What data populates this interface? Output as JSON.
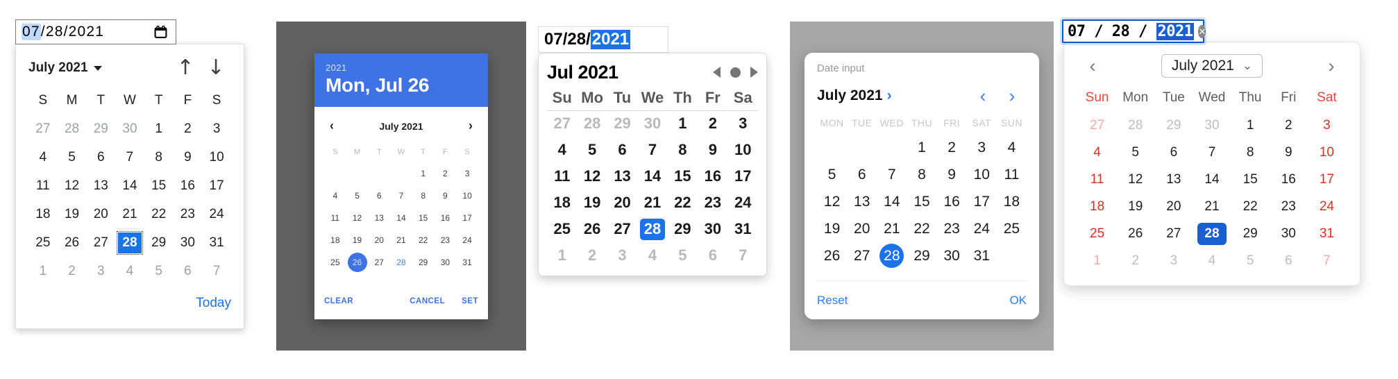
{
  "panels": [
    {
      "id": "chrome-date-picker",
      "input": {
        "month": "07",
        "day": "28",
        "year": "2021",
        "sep": "/",
        "selected_segment": "month",
        "icon": "calendar-icon"
      },
      "header": {
        "month_year": "July 2021",
        "caret": "chevron-down-icon",
        "prev_icon": "arrow-up-icon",
        "next_icon": "arrow-down-icon"
      },
      "weekdays": [
        "S",
        "M",
        "T",
        "W",
        "T",
        "F",
        "S"
      ],
      "weeks": [
        [
          {
            "d": "27",
            "o": true
          },
          {
            "d": "28",
            "o": true
          },
          {
            "d": "29",
            "o": true
          },
          {
            "d": "30",
            "o": true
          },
          {
            "d": "1"
          },
          {
            "d": "2"
          },
          {
            "d": "3"
          }
        ],
        [
          {
            "d": "4"
          },
          {
            "d": "5"
          },
          {
            "d": "6"
          },
          {
            "d": "7"
          },
          {
            "d": "8"
          },
          {
            "d": "9"
          },
          {
            "d": "10"
          }
        ],
        [
          {
            "d": "11"
          },
          {
            "d": "12"
          },
          {
            "d": "13"
          },
          {
            "d": "14"
          },
          {
            "d": "15"
          },
          {
            "d": "16"
          },
          {
            "d": "17"
          }
        ],
        [
          {
            "d": "18"
          },
          {
            "d": "19"
          },
          {
            "d": "20"
          },
          {
            "d": "21"
          },
          {
            "d": "22"
          },
          {
            "d": "23"
          },
          {
            "d": "24"
          }
        ],
        [
          {
            "d": "25"
          },
          {
            "d": "26"
          },
          {
            "d": "27"
          },
          {
            "d": "28",
            "s": true
          },
          {
            "d": "29"
          },
          {
            "d": "30"
          },
          {
            "d": "31"
          }
        ],
        [
          {
            "d": "1",
            "o": true
          },
          {
            "d": "2",
            "o": true
          },
          {
            "d": "3",
            "o": true
          },
          {
            "d": "4",
            "o": true
          },
          {
            "d": "5",
            "o": true
          },
          {
            "d": "6",
            "o": true
          },
          {
            "d": "7",
            "o": true
          }
        ]
      ],
      "footer": {
        "today_label": "Today"
      },
      "accent": "#1a73e8"
    },
    {
      "id": "material-date-picker",
      "backdrop": "#616161",
      "header": {
        "year": "2021",
        "date": "Mon, Jul 26",
        "bg": "#3f72e3"
      },
      "nav": {
        "prev_icon": "chevron-left-icon",
        "month_year": "July 2021",
        "next_icon": "chevron-right-icon"
      },
      "weekdays": [
        "S",
        "M",
        "T",
        "W",
        "T",
        "F",
        "S"
      ],
      "weeks": [
        [
          {
            "d": ""
          },
          {
            "d": ""
          },
          {
            "d": ""
          },
          {
            "d": ""
          },
          {
            "d": "1"
          },
          {
            "d": "2"
          },
          {
            "d": "3"
          }
        ],
        [
          {
            "d": "4"
          },
          {
            "d": "5"
          },
          {
            "d": "6"
          },
          {
            "d": "7"
          },
          {
            "d": "8"
          },
          {
            "d": "9"
          },
          {
            "d": "10"
          }
        ],
        [
          {
            "d": "11"
          },
          {
            "d": "12"
          },
          {
            "d": "13"
          },
          {
            "d": "14"
          },
          {
            "d": "15"
          },
          {
            "d": "16"
          },
          {
            "d": "17"
          }
        ],
        [
          {
            "d": "18"
          },
          {
            "d": "19"
          },
          {
            "d": "20"
          },
          {
            "d": "21"
          },
          {
            "d": "22"
          },
          {
            "d": "23"
          },
          {
            "d": "24"
          }
        ],
        [
          {
            "d": "25"
          },
          {
            "d": "26",
            "s": true
          },
          {
            "d": "27"
          },
          {
            "d": "28",
            "t": true
          },
          {
            "d": "29"
          },
          {
            "d": "30"
          },
          {
            "d": "31"
          }
        ]
      ],
      "actions": {
        "clear": "CLEAR",
        "cancel": "CANCEL",
        "set": "SET"
      },
      "accent": "#3f72e3"
    },
    {
      "id": "safari-date-picker",
      "input": {
        "month": "07",
        "day": "28",
        "year": "2021",
        "sep": "/",
        "selected_segment": "year"
      },
      "header": {
        "month_year": "Jul 2021",
        "prev_icon": "triangle-left-icon",
        "today_icon": "circle-dot-icon",
        "next_icon": "triangle-right-icon"
      },
      "weekdays": [
        "Su",
        "Mo",
        "Tu",
        "We",
        "Th",
        "Fr",
        "Sa"
      ],
      "weeks": [
        [
          {
            "d": "27",
            "o": true
          },
          {
            "d": "28",
            "o": true
          },
          {
            "d": "29",
            "o": true
          },
          {
            "d": "30",
            "o": true
          },
          {
            "d": "1"
          },
          {
            "d": "2"
          },
          {
            "d": "3"
          }
        ],
        [
          {
            "d": "4"
          },
          {
            "d": "5"
          },
          {
            "d": "6"
          },
          {
            "d": "7"
          },
          {
            "d": "8"
          },
          {
            "d": "9"
          },
          {
            "d": "10"
          }
        ],
        [
          {
            "d": "11"
          },
          {
            "d": "12"
          },
          {
            "d": "13"
          },
          {
            "d": "14"
          },
          {
            "d": "15"
          },
          {
            "d": "16"
          },
          {
            "d": "17"
          }
        ],
        [
          {
            "d": "18"
          },
          {
            "d": "19"
          },
          {
            "d": "20"
          },
          {
            "d": "21"
          },
          {
            "d": "22"
          },
          {
            "d": "23"
          },
          {
            "d": "24"
          }
        ],
        [
          {
            "d": "25"
          },
          {
            "d": "26"
          },
          {
            "d": "27"
          },
          {
            "d": "28",
            "s": true
          },
          {
            "d": "29"
          },
          {
            "d": "30"
          },
          {
            "d": "31"
          }
        ],
        [
          {
            "d": "1",
            "o": true
          },
          {
            "d": "2",
            "o": true
          },
          {
            "d": "3",
            "o": true
          },
          {
            "d": "4",
            "o": true
          },
          {
            "d": "5",
            "o": true
          },
          {
            "d": "6",
            "o": true
          },
          {
            "d": "7",
            "o": true
          }
        ]
      ],
      "accent": "#1a73e8"
    },
    {
      "id": "fluent-date-picker",
      "backdrop": "#a6a6a6",
      "label": "Date input",
      "nav": {
        "month_year": "July 2021",
        "expand_icon": "chevron-right-icon",
        "prev_icon": "chevron-left-icon",
        "next_icon": "chevron-right-icon"
      },
      "weekdays": [
        "MON",
        "TUE",
        "WED",
        "THU",
        "FRI",
        "SAT",
        "SUN"
      ],
      "weeks": [
        [
          {
            "d": ""
          },
          {
            "d": ""
          },
          {
            "d": ""
          },
          {
            "d": "1"
          },
          {
            "d": "2"
          },
          {
            "d": "3"
          },
          {
            "d": "4"
          }
        ],
        [
          {
            "d": "5"
          },
          {
            "d": "6"
          },
          {
            "d": "7"
          },
          {
            "d": "8"
          },
          {
            "d": "9"
          },
          {
            "d": "10"
          },
          {
            "d": "11"
          }
        ],
        [
          {
            "d": "12"
          },
          {
            "d": "13"
          },
          {
            "d": "14"
          },
          {
            "d": "15"
          },
          {
            "d": "16"
          },
          {
            "d": "17"
          },
          {
            "d": "18"
          }
        ],
        [
          {
            "d": "19"
          },
          {
            "d": "20"
          },
          {
            "d": "21"
          },
          {
            "d": "22"
          },
          {
            "d": "23"
          },
          {
            "d": "24"
          },
          {
            "d": "25"
          }
        ],
        [
          {
            "d": "26"
          },
          {
            "d": "27"
          },
          {
            "d": "28",
            "s": true
          },
          {
            "d": "29"
          },
          {
            "d": "30"
          },
          {
            "d": "31"
          },
          {
            "d": ""
          }
        ]
      ],
      "actions": {
        "reset": "Reset",
        "ok": "OK"
      },
      "accent": "#1a73e8"
    },
    {
      "id": "edge-date-picker",
      "input": {
        "month": "07",
        "day": "28",
        "year": "2021",
        "sep": "/",
        "selected_segment": "year",
        "clear_icon": "clear-circle-icon"
      },
      "header": {
        "prev_icon": "chevron-left-icon",
        "month_year": "July 2021",
        "dropdown_icon": "chevron-down-icon",
        "next_icon": "chevron-right-icon"
      },
      "weekdays": [
        "Sun",
        "Mon",
        "Tue",
        "Wed",
        "Thu",
        "Fri",
        "Sat"
      ],
      "weeks": [
        [
          {
            "d": "27",
            "o": true,
            "w": true
          },
          {
            "d": "28",
            "o": true
          },
          {
            "d": "29",
            "o": true
          },
          {
            "d": "30",
            "o": true
          },
          {
            "d": "1"
          },
          {
            "d": "2"
          },
          {
            "d": "3",
            "w": true
          }
        ],
        [
          {
            "d": "4",
            "w": true
          },
          {
            "d": "5"
          },
          {
            "d": "6"
          },
          {
            "d": "7"
          },
          {
            "d": "8"
          },
          {
            "d": "9"
          },
          {
            "d": "10",
            "w": true
          }
        ],
        [
          {
            "d": "11",
            "w": true
          },
          {
            "d": "12"
          },
          {
            "d": "13"
          },
          {
            "d": "14"
          },
          {
            "d": "15"
          },
          {
            "d": "16"
          },
          {
            "d": "17",
            "w": true
          }
        ],
        [
          {
            "d": "18",
            "w": true
          },
          {
            "d": "19"
          },
          {
            "d": "20"
          },
          {
            "d": "21"
          },
          {
            "d": "22"
          },
          {
            "d": "23"
          },
          {
            "d": "24",
            "w": true
          }
        ],
        [
          {
            "d": "25",
            "w": true
          },
          {
            "d": "26"
          },
          {
            "d": "27"
          },
          {
            "d": "28",
            "s": true
          },
          {
            "d": "29"
          },
          {
            "d": "30"
          },
          {
            "d": "31",
            "w": true
          }
        ],
        [
          {
            "d": "1",
            "o": true,
            "w": true
          },
          {
            "d": "2",
            "o": true
          },
          {
            "d": "3",
            "o": true
          },
          {
            "d": "4",
            "o": true
          },
          {
            "d": "5",
            "o": true
          },
          {
            "d": "6",
            "o": true
          },
          {
            "d": "7",
            "o": true,
            "w": true
          }
        ]
      ],
      "accent": "#1a5fd0",
      "weekend_color": "#d93025"
    }
  ]
}
